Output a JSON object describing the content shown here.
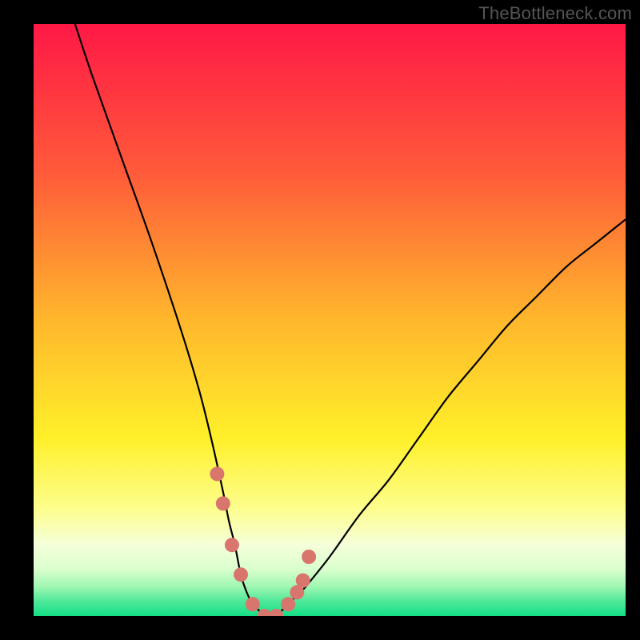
{
  "watermark": "TheBottleneck.com",
  "chart_data": {
    "type": "line",
    "title": "",
    "xlabel": "",
    "ylabel": "",
    "xlim": [
      0,
      100
    ],
    "ylim": [
      0,
      100
    ],
    "grid": false,
    "series": [
      {
        "name": "bottleneck-curve",
        "x": [
          7,
          10,
          15,
          20,
          25,
          28,
          30,
          32,
          33,
          34,
          35,
          36,
          37,
          38,
          39,
          40,
          41,
          42,
          43,
          44,
          45,
          46,
          50,
          55,
          60,
          65,
          70,
          75,
          80,
          85,
          90,
          95,
          100
        ],
        "values": [
          100,
          91,
          77,
          63,
          48,
          38,
          30,
          21,
          16,
          12,
          7,
          4,
          2,
          1,
          0,
          0,
          0,
          1,
          2,
          3,
          4,
          5,
          10,
          17,
          23,
          30,
          37,
          43,
          49,
          54,
          59,
          63,
          67
        ]
      }
    ],
    "markers": {
      "name": "highlight-points",
      "x": [
        31,
        32,
        33.5,
        35,
        37,
        39,
        41,
        43,
        44.5,
        45.5,
        46.5
      ],
      "values": [
        24,
        19,
        12,
        7,
        2,
        0,
        0,
        2,
        4,
        6,
        10
      ],
      "color": "#d8766e"
    },
    "background_gradient": {
      "stops": [
        {
          "pos": 0.0,
          "color": "#ff1846"
        },
        {
          "pos": 0.25,
          "color": "#ff5a3a"
        },
        {
          "pos": 0.5,
          "color": "#ffb72c"
        },
        {
          "pos": 0.7,
          "color": "#fff02a"
        },
        {
          "pos": 0.82,
          "color": "#fdfe8e"
        },
        {
          "pos": 0.88,
          "color": "#f5ffda"
        },
        {
          "pos": 0.92,
          "color": "#dbffce"
        },
        {
          "pos": 0.95,
          "color": "#a0f7b2"
        },
        {
          "pos": 0.975,
          "color": "#4fe899"
        },
        {
          "pos": 1.0,
          "color": "#13df86"
        }
      ]
    }
  }
}
